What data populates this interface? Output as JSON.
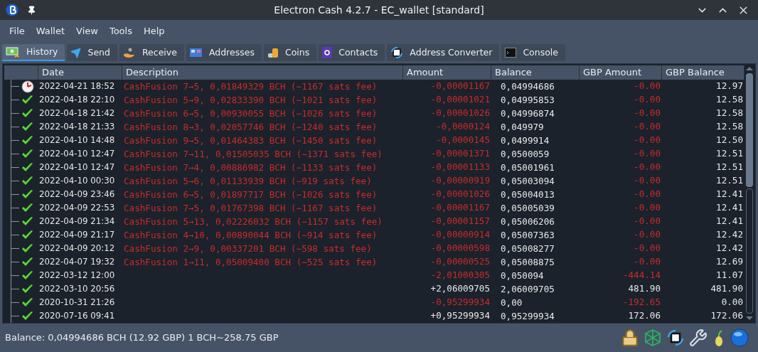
{
  "window": {
    "title": "Electron Cash 4.2.7 - EC_wallet [standard]"
  },
  "menu": [
    "File",
    "Wallet",
    "View",
    "Tools",
    "Help"
  ],
  "tabs": [
    {
      "label": "History",
      "selected": true,
      "kind": "history"
    },
    {
      "label": "Send",
      "selected": false,
      "kind": "send"
    },
    {
      "label": "Receive",
      "selected": false,
      "kind": "receive"
    },
    {
      "label": "Addresses",
      "selected": false,
      "kind": "addresses"
    },
    {
      "label": "Coins",
      "selected": false,
      "kind": "coins"
    },
    {
      "label": "Contacts",
      "selected": false,
      "kind": "contacts"
    },
    {
      "label": "Address Converter",
      "selected": false,
      "kind": "converter"
    },
    {
      "label": "Console",
      "selected": false,
      "kind": "console"
    }
  ],
  "table": {
    "columns": [
      "Date",
      "Description",
      "Amount",
      "Balance",
      "GBP Amount",
      "GBP Balance"
    ],
    "rows": [
      {
        "kind": "pending",
        "date": "2022-04-21 18:52",
        "description": "CashFusion 7→5, 0,01849329 BCH (−1167 sats fee)",
        "amount": "-0,00001167",
        "amount_negative": true,
        "balance": "0,04994686",
        "gbp_amount": "-0.00",
        "gbp_negative": true,
        "gbp_balance": "12.97"
      },
      {
        "kind": "confirmed",
        "date": "2022-04-18 22:10",
        "description": "CashFusion 5→9, 0,02833390 BCH (−1021 sats fee)",
        "amount": "-0,00001021",
        "amount_negative": true,
        "balance": "0,04995853",
        "gbp_amount": "-0.00",
        "gbp_negative": true,
        "gbp_balance": "12.58"
      },
      {
        "kind": "confirmed",
        "date": "2022-04-18 21:42",
        "description": "CashFusion 6→5, 0,00930055 BCH (−1026 sats fee)",
        "amount": "-0,00001026",
        "amount_negative": true,
        "balance": "0,04996874",
        "gbp_amount": "-0.00",
        "gbp_negative": true,
        "gbp_balance": "12.58"
      },
      {
        "kind": "confirmed",
        "date": "2022-04-18 21:33",
        "description": "CashFusion 8→3, 0,02057746 BCH (−1240 sats fee)",
        "amount": "-0,0000124",
        "amount_negative": true,
        "balance": "0,049979",
        "gbp_amount": "-0.00",
        "gbp_negative": true,
        "gbp_balance": "12.58"
      },
      {
        "kind": "confirmed",
        "date": "2022-04-10 14:48",
        "description": "CashFusion 9→5, 0,01464383 BCH (−1450 sats fee)",
        "amount": "-0,0000145",
        "amount_negative": true,
        "balance": "0,0499914",
        "gbp_amount": "-0.00",
        "gbp_negative": true,
        "gbp_balance": "12.50"
      },
      {
        "kind": "confirmed",
        "date": "2022-04-10 12:47",
        "description": "CashFusion 7→11, 0,01505035 BCH (−1371 sats fee)",
        "amount": "-0,00001371",
        "amount_negative": true,
        "balance": "0,0500059",
        "gbp_amount": "-0.00",
        "gbp_negative": true,
        "gbp_balance": "12.51"
      },
      {
        "kind": "confirmed",
        "date": "2022-04-10 12:47",
        "description": "CashFusion 7→4, 0,00886982 BCH (−1133 sats fee)",
        "amount": "-0,00001133",
        "amount_negative": true,
        "balance": "0,05001961",
        "gbp_amount": "-0.00",
        "gbp_negative": true,
        "gbp_balance": "12.51"
      },
      {
        "kind": "confirmed",
        "date": "2022-04-10 00:30",
        "description": "CashFusion 5→6, 0,01133939 BCH (−919 sats fee)",
        "amount": "-0,00000919",
        "amount_negative": true,
        "balance": "0,05003094",
        "gbp_amount": "-0.00",
        "gbp_negative": true,
        "gbp_balance": "12.51"
      },
      {
        "kind": "confirmed",
        "date": "2022-04-09 23:46",
        "description": "CashFusion 6→5, 0,01897717 BCH (−1026 sats fee)",
        "amount": "-0,00001026",
        "amount_negative": true,
        "balance": "0,05004013",
        "gbp_amount": "-0.00",
        "gbp_negative": true,
        "gbp_balance": "12.41"
      },
      {
        "kind": "confirmed",
        "date": "2022-04-09 22:53",
        "description": "CashFusion 7→5, 0,01767398 BCH (−1167 sats fee)",
        "amount": "-0,00001167",
        "amount_negative": true,
        "balance": "0,05005039",
        "gbp_amount": "-0.00",
        "gbp_negative": true,
        "gbp_balance": "12.41"
      },
      {
        "kind": "confirmed",
        "date": "2022-04-09 21:34",
        "description": "CashFusion 5→13, 0,02226032 BCH (−1157 sats fee)",
        "amount": "-0,00001157",
        "amount_negative": true,
        "balance": "0,05006206",
        "gbp_amount": "-0.00",
        "gbp_negative": true,
        "gbp_balance": "12.41"
      },
      {
        "kind": "confirmed",
        "date": "2022-04-09 21:17",
        "description": "CashFusion 4→10, 0,00890044 BCH (−914 sats fee)",
        "amount": "-0,00000914",
        "amount_negative": true,
        "balance": "0,05007363",
        "gbp_amount": "-0.00",
        "gbp_negative": true,
        "gbp_balance": "12.42"
      },
      {
        "kind": "confirmed",
        "date": "2022-04-09 20:12",
        "description": "CashFusion 2→9, 0,00337201 BCH (−598 sats fee)",
        "amount": "-0,00000598",
        "amount_negative": true,
        "balance": "0,05008277",
        "gbp_amount": "-0.00",
        "gbp_negative": true,
        "gbp_balance": "12.42"
      },
      {
        "kind": "confirmed",
        "date": "2022-04-07 19:32",
        "description": "CashFusion 1→11, 0,05009400 BCH (−525 sats fee)",
        "amount": "-0,00000525",
        "amount_negative": true,
        "balance": "0,05008875",
        "gbp_amount": "-0.00",
        "gbp_negative": true,
        "gbp_balance": "12.69"
      },
      {
        "kind": "confirmed",
        "date": "2022-03-12 12:00",
        "amount": "-2,01000305",
        "amount_negative": true,
        "balance": "0,050094",
        "gbp_amount": "-444.14",
        "gbp_negative": true,
        "gbp_balance": "11.07"
      },
      {
        "kind": "confirmed",
        "date": "2022-03-10 20:56",
        "amount": "+2,06009705",
        "amount_negative": false,
        "balance": "2,06009705",
        "gbp_amount": "481.90",
        "gbp_negative": false,
        "gbp_balance": "481.90"
      },
      {
        "kind": "confirmed",
        "date": "2020-10-31 21:26",
        "amount": "-0,95299934",
        "amount_negative": true,
        "balance": "0,00",
        "gbp_amount": "-192.65",
        "gbp_negative": true,
        "gbp_balance": "0.00"
      },
      {
        "kind": "confirmed",
        "date": "2020-07-16 09:41",
        "amount": "+0,95299934",
        "amount_negative": false,
        "balance": "0,95299934",
        "gbp_amount": "172.06",
        "gbp_negative": false,
        "gbp_balance": "172.06"
      }
    ]
  },
  "status_bar": {
    "text": "Balance: 0,04994686 BCH (12.92 GBP) 1 BCH~258.75 GBP"
  }
}
